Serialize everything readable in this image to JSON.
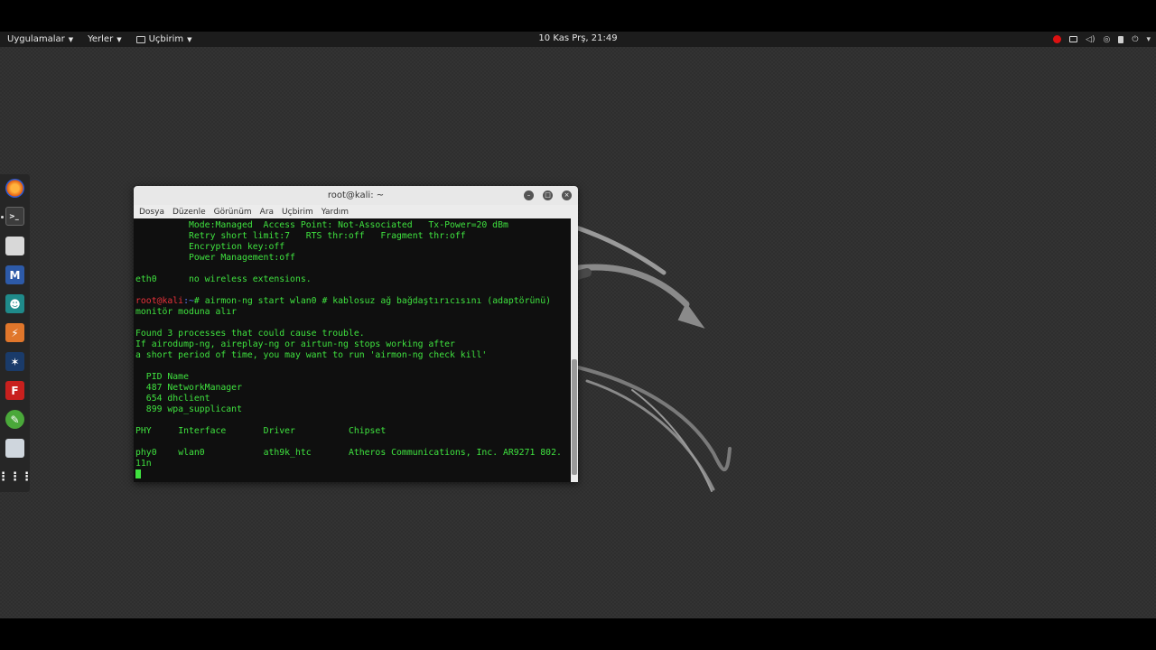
{
  "topbar": {
    "applications": "Uygulamalar",
    "places": "Yerler",
    "terminal_app": "Uçbirim",
    "clock": "10 Kas Prş, 21:49"
  },
  "window": {
    "title": "root@kali: ~",
    "menu": [
      "Dosya",
      "Düzenle",
      "Görünüm",
      "Ara",
      "Uçbirim",
      "Yardım"
    ]
  },
  "terminal": {
    "lines": [
      "          Mode:Managed  Access Point: Not-Associated   Tx-Power=20 dBm",
      "          Retry short limit:7   RTS thr:off   Fragment thr:off",
      "          Encryption key:off",
      "          Power Management:off",
      "",
      "eth0      no wireless extensions.",
      ""
    ],
    "prompt_user": "root@kali",
    "prompt_path": ":~",
    "prompt_symbol": "# ",
    "command": "airmon-ng start wlan0 # kablosuz ağ bağdaştırıcısını (adaptörünü)",
    "command_wrap": "monitör moduna alır",
    "output": [
      "",
      "Found 3 processes that could cause trouble.",
      "If airodump-ng, aireplay-ng or airtun-ng stops working after",
      "a short period of time, you may want to run 'airmon-ng check kill'",
      "",
      "  PID Name",
      "  487 NetworkManager",
      "  654 dhclient",
      "  899 wpa_supplicant",
      "",
      "PHY\tInterface\tDriver\t\tChipset",
      "",
      "phy0\twlan0\t\tath9k_htc\tAtheros Communications, Inc. AR9271 802.",
      "11n"
    ]
  },
  "colors": {
    "terminal_text": "#3fe23f",
    "prompt_user": "#e8313a",
    "prompt_path": "#5d7cff",
    "topbar": "#1c1c1c",
    "record_indicator": "#dd1111"
  },
  "dock": {
    "items": [
      "firefox-icon",
      "terminal-icon",
      "files-icon",
      "metasploit-icon",
      "armitage-icon",
      "burpsuite-icon",
      "maltego-icon",
      "faraday-icon",
      "leafpad-icon",
      "settings-icon",
      "app-grid-icon"
    ]
  }
}
